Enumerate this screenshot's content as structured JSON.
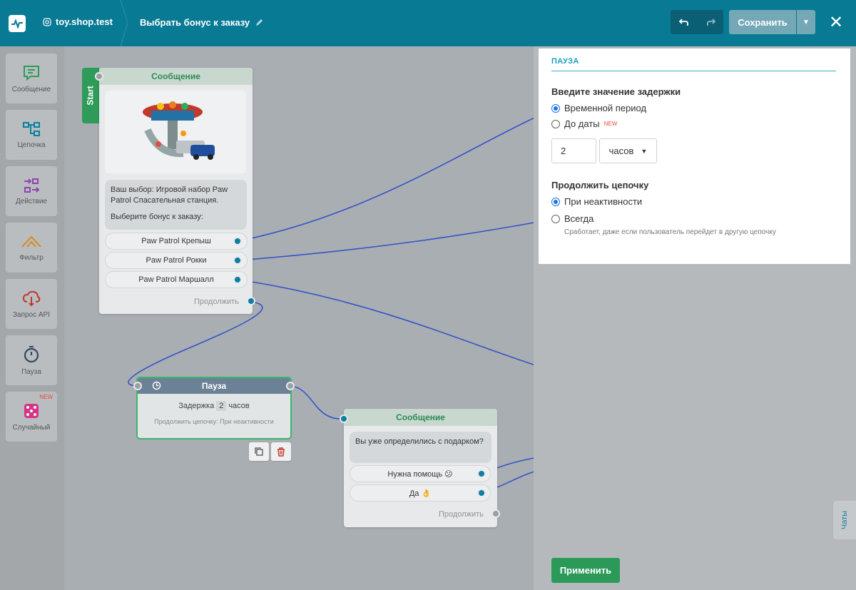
{
  "header": {
    "account": "toy.shop.test",
    "flow_title": "Выбрать бонус к заказу",
    "save_label": "Сохранить"
  },
  "tools": [
    {
      "label": "Сообщение",
      "icon": "message-icon"
    },
    {
      "label": "Цепочка",
      "icon": "chain-icon"
    },
    {
      "label": "Действие",
      "icon": "action-icon"
    },
    {
      "label": "Фильтр",
      "icon": "filter-icon"
    },
    {
      "label": "Запрос API",
      "icon": "api-request-icon"
    },
    {
      "label": "Пауза",
      "icon": "pause-timer-icon"
    },
    {
      "label": "Случайный",
      "icon": "dice-icon",
      "badge": "NEW"
    }
  ],
  "start_node": {
    "start_label": "Start",
    "title": "Сообщение",
    "text_line1": "Ваш выбор: Игровой набор Paw Patrol Спасательная станция.",
    "text_line2": "Выберите бонус к заказу:",
    "buttons": [
      "Paw Patrol Крепыш",
      "Paw Patrol Рокки",
      "Paw Patrol Маршалл"
    ],
    "continue": "Продолжить"
  },
  "pause_node": {
    "title": "Пауза",
    "delay_prefix": "Задержка",
    "delay_value": "2",
    "delay_unit": "часов",
    "continue_text": "Продолжить цепочку: При неактивности"
  },
  "message_node2": {
    "title": "Сообщение",
    "text": "Вы уже определились с подарком?",
    "buttons": [
      "Нужна помощь 😕",
      "Да 👌"
    ],
    "continue": "Продолжить"
  },
  "settings": {
    "title": "ПАУЗА",
    "delay_label": "Введите значение задержки",
    "option_period": "Временной период",
    "option_date": "До даты",
    "new_badge": "NEW",
    "value": "2",
    "unit": "часов",
    "continue_label": "Продолжить цепочку",
    "option_inactive": "При неактивности",
    "option_always": "Всегда",
    "hint": "Сработает, даже если пользователь перейдет в другую цепочку",
    "apply_label": "Применить"
  },
  "chats_label": "Чаты",
  "colors": {
    "header": "#087a93",
    "accent_green": "#2b9a59",
    "port_blue": "#0d7fa0",
    "wire_blue": "#3553c9"
  }
}
